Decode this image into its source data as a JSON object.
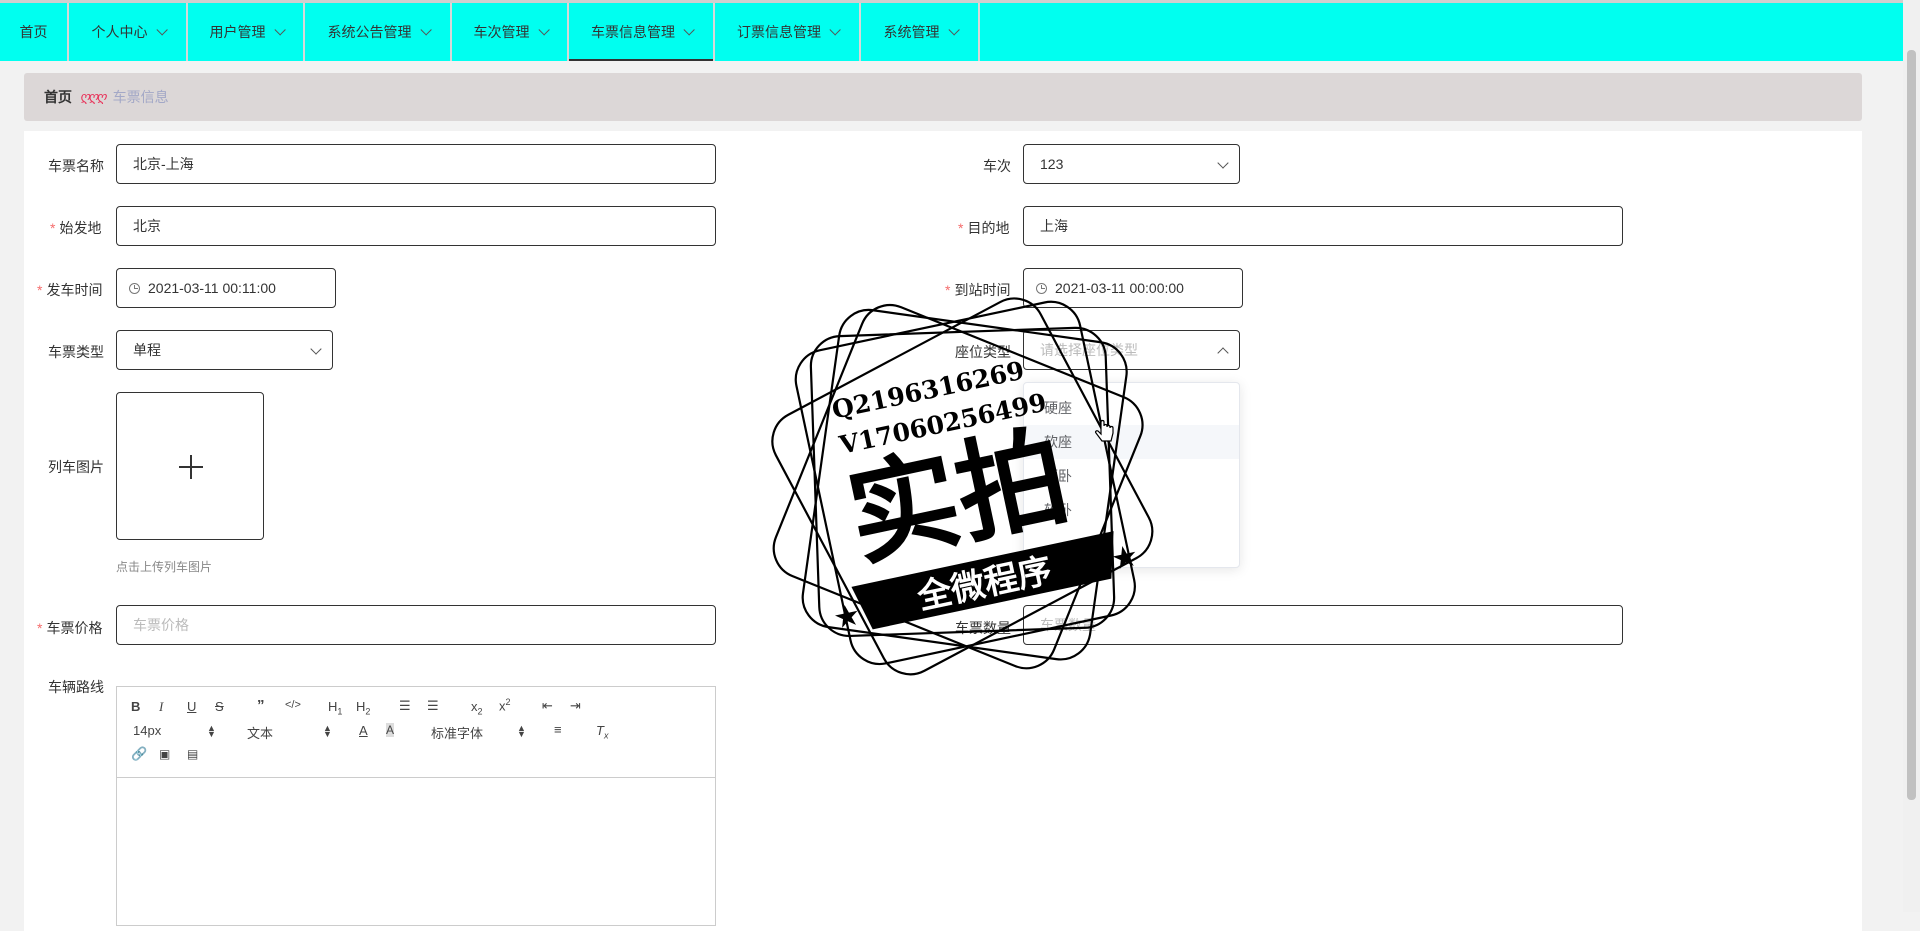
{
  "nav": {
    "items": [
      {
        "label": "首页",
        "dropdown": false,
        "active": false
      },
      {
        "label": "个人中心",
        "dropdown": true,
        "active": false
      },
      {
        "label": "用户管理",
        "dropdown": true,
        "active": false
      },
      {
        "label": "系统公告管理",
        "dropdown": true,
        "active": false
      },
      {
        "label": "车次管理",
        "dropdown": true,
        "active": false
      },
      {
        "label": "车票信息管理",
        "dropdown": true,
        "active": true
      },
      {
        "label": "订票信息管理",
        "dropdown": true,
        "active": false
      },
      {
        "label": "系统管理",
        "dropdown": true,
        "active": false
      }
    ]
  },
  "breadcrumb": {
    "home": "首页",
    "separator": "ღღღ",
    "current": "车票信息"
  },
  "form": {
    "ticket_name": {
      "label": "车票名称",
      "value": "北京-上海"
    },
    "train_no": {
      "label": "车次",
      "value": "123"
    },
    "origin": {
      "label": "始发地",
      "value": "北京"
    },
    "destination": {
      "label": "目的地",
      "value": "上海"
    },
    "depart_time": {
      "label": "发车时间",
      "value": "2021-03-11 00:11:00"
    },
    "arrive_time": {
      "label": "到站时间",
      "value": "2021-03-11 00:00:00"
    },
    "ticket_type": {
      "label": "车票类型",
      "value": "单程"
    },
    "seat_type": {
      "label": "座位类型",
      "placeholder": "请选择座位类型"
    },
    "train_image": {
      "label": "列车图片",
      "tip": "点击上传列车图片"
    },
    "price": {
      "label": "车票价格",
      "placeholder": "车票价格"
    },
    "quantity": {
      "label": "车票数量",
      "placeholder": "车票数量"
    },
    "route": {
      "label": "车辆路线"
    }
  },
  "seat_options": [
    "硬座",
    "软座",
    "硬卧",
    "软卧"
  ],
  "editor": {
    "font_size": "14px",
    "block_type": "文本",
    "font_family": "标准字体"
  },
  "watermark": {
    "line1": "Q2196316269",
    "line2": "V17060256499",
    "big": "实拍",
    "banner": "全微程序"
  },
  "colors": {
    "nav_bg": "#00fff0",
    "breadcrumb_bg": "#dcd7d7",
    "required": "#f56c6c",
    "separator": "#e8335a"
  }
}
